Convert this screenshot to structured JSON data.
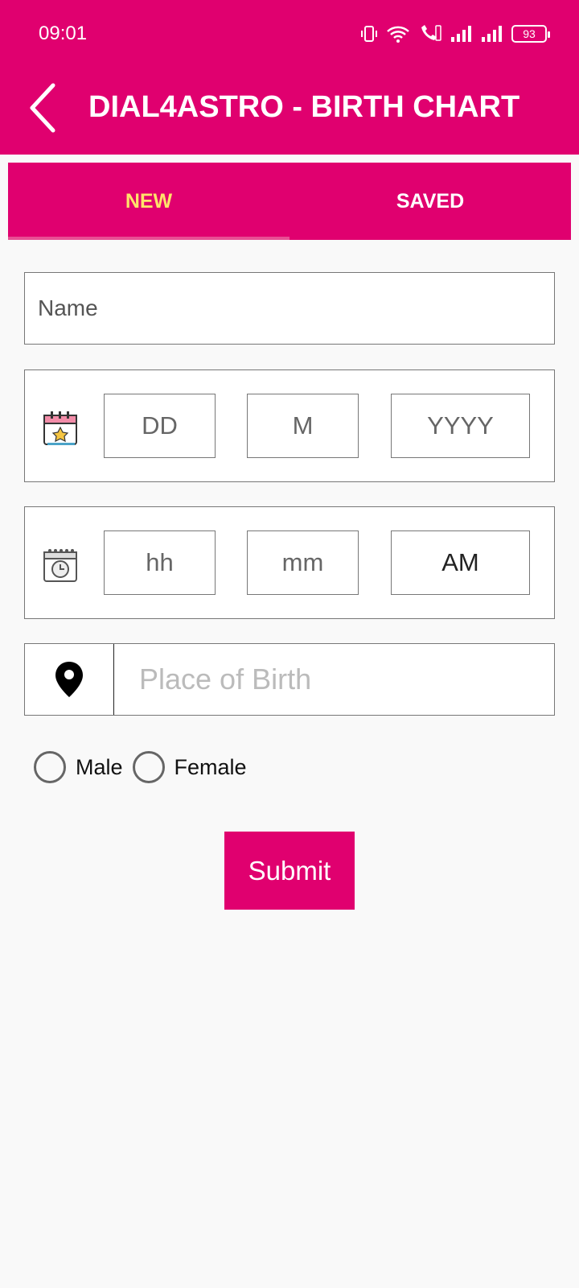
{
  "status_bar": {
    "time": "09:01",
    "battery": "93",
    "icons": [
      "vibrate-icon",
      "wifi-icon",
      "volte-call-icon",
      "signal-icon",
      "signal-icon",
      "battery-icon"
    ]
  },
  "header": {
    "title": "DIAL4ASTRO - BIRTH CHART",
    "back_icon": "chevron-left-icon"
  },
  "tabs": [
    {
      "label": "NEW",
      "active": true
    },
    {
      "label": "SAVED",
      "active": false
    }
  ],
  "form": {
    "name_placeholder": "Name",
    "date": {
      "icon": "calendar-icon",
      "day": "DD",
      "month": "M",
      "year": "YYYY"
    },
    "time": {
      "icon": "clock-calendar-icon",
      "hour": "hh",
      "minute": "mm",
      "ampm": "AM"
    },
    "place": {
      "icon": "location-pin-icon",
      "placeholder": "Place of Birth"
    },
    "gender_options": [
      "Male",
      "Female"
    ],
    "submit_label": "Submit"
  },
  "colors": {
    "primary": "#e0006f",
    "tab_active_text": "#ffe36a",
    "background": "#f9f9f9"
  }
}
